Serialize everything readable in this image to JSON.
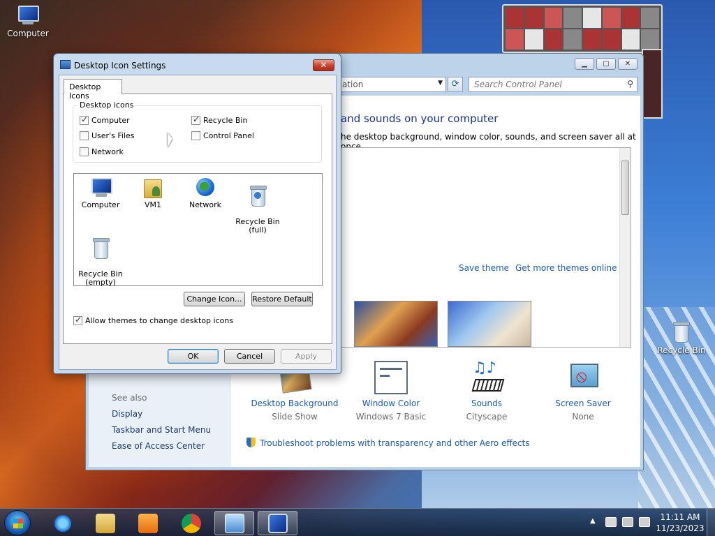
{
  "desktop": {
    "icons": [
      {
        "label": "Computer"
      },
      {
        "label": "Recycle Bin"
      }
    ]
  },
  "control_panel": {
    "address_text": "ation",
    "search_placeholder": "Search Control Panel",
    "heading": "and sounds on your computer",
    "description": "he desktop background, window color, sounds, and screen saver all at once.",
    "save_theme": "Save theme",
    "get_more_themes": "Get more themes online",
    "see_also": "See also",
    "left_links": [
      "Display",
      "Taskbar and Start Menu",
      "Ease of Access Center"
    ],
    "tiles": [
      {
        "label": "Desktop Background",
        "sub": "Slide Show",
        "icon": "desktop-background-icon"
      },
      {
        "label": "Window Color",
        "sub": "Windows 7 Basic",
        "icon": "window-color-icon"
      },
      {
        "label": "Sounds",
        "sub": "Cityscape",
        "icon": "sounds-icon"
      },
      {
        "label": "Screen Saver",
        "sub": "None",
        "icon": "screen-saver-icon"
      }
    ],
    "troubleshoot": "Troubleshoot problems with transparency and other Aero effects"
  },
  "dialog": {
    "title": "Desktop Icon Settings",
    "close_label": "✕",
    "tab_label": "Desktop Icons",
    "group_label": "Desktop icons",
    "checkboxes": [
      {
        "label": "Computer",
        "checked": true
      },
      {
        "label": "User's Files",
        "checked": false
      },
      {
        "label": "Network",
        "checked": false
      },
      {
        "label": "Recycle Bin",
        "checked": true
      },
      {
        "label": "Control Panel",
        "checked": false
      }
    ],
    "icon_list": [
      {
        "label": "Computer"
      },
      {
        "label": "VM1"
      },
      {
        "label": "Network"
      },
      {
        "label": "Recycle Bin\n(full)"
      },
      {
        "label": "Recycle Bin\n(empty)"
      }
    ],
    "change_icon": "Change Icon...",
    "restore_default": "Restore Default",
    "allow_themes": {
      "label": "Allow themes to change desktop icons",
      "checked": true
    },
    "ok": "OK",
    "cancel": "Cancel",
    "apply": "Apply"
  },
  "taskbar": {
    "clock_time": "11:11 AM",
    "clock_date": "11/23/2023"
  },
  "colors": {
    "link": "#1e5aa8",
    "heading": "#1e3287",
    "dialog_frame": "#c7daee"
  }
}
